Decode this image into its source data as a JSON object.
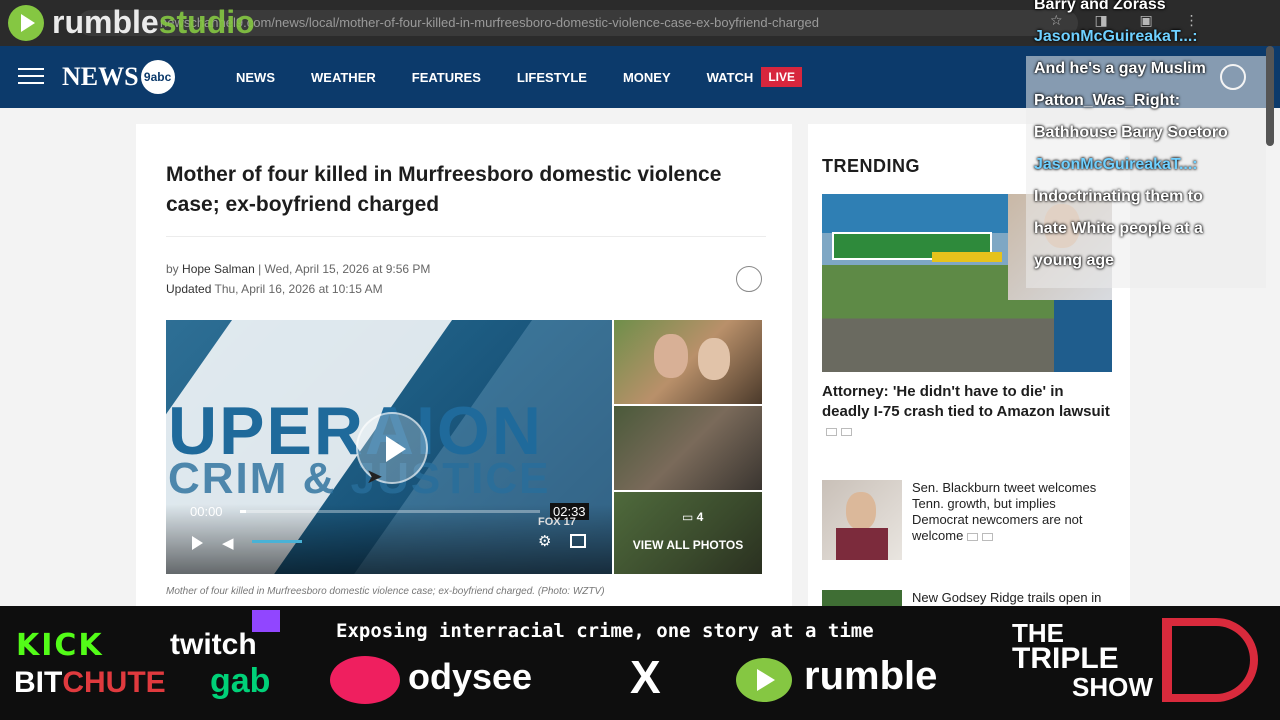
{
  "browser": {
    "url": "newschannel9.com/news/local/mother-of-four-killed-in-murfreesboro-domestic-violence-case-ex-boyfriend-charged",
    "watermark": {
      "brand": "rumble",
      "suffix": "studio"
    }
  },
  "site": {
    "logo_text": "NEWS",
    "logo_badge": "9abc",
    "nav": [
      "NEWS",
      "WEATHER",
      "FEATURES",
      "LIFESTYLE",
      "MONEY",
      "WATCH"
    ],
    "live_label": "LIVE"
  },
  "article": {
    "title": "Mother of four killed in Murfreesboro domestic violence case; ex-boyfriend charged",
    "byline_prefix": "by",
    "author": "Hope Salman",
    "published": "| Wed, April 15, 2026 at 9:56 PM",
    "updated_label": "Updated",
    "updated": "Thu, April 16, 2026 at 10:15 AM",
    "video": {
      "overlay_line1": "UPERAION",
      "overlay_line2": "CRIM & JUSTICE",
      "time_current": "00:00",
      "time_total": "02:33",
      "progress": 0.02,
      "channel_badge": "FOX 17"
    },
    "photo_count": "4",
    "view_all": "VIEW ALL PHOTOS",
    "caption": "Mother of four killed in Murfreesboro domestic violence case; ex-boyfriend charged. (Photo: WZTV)"
  },
  "trending": {
    "title": "TRENDING",
    "lead_headline": "Attorney: 'He didn't have to die' in deadly I-75 crash tied to Amazon lawsuit",
    "items": [
      {
        "headline": "Sen. Blackburn tweet welcomes Tenn. growth, but implies Democrat newcomers are not welcome"
      },
      {
        "headline": "New Godsey Ridge trails open in Red Bank"
      }
    ]
  },
  "chat": [
    {
      "text": "Barry and Zorass",
      "kind": "msg"
    },
    {
      "text": "JasonMcGuireakaT...:",
      "kind": "user"
    },
    {
      "text": "And he's a gay Muslim",
      "kind": "msg"
    },
    {
      "text": "Patton_Was_Right:",
      "kind": "msg"
    },
    {
      "text": "Bathhouse Barry Soetoro",
      "kind": "msg"
    },
    {
      "text": "JasonMcGuireakaT...:",
      "kind": "user"
    },
    {
      "text": "Indoctrinating them to",
      "kind": "msg"
    },
    {
      "text": "hate White people at a",
      "kind": "msg"
    },
    {
      "text": "young age",
      "kind": "msg"
    }
  ],
  "banner": {
    "tagline": "Exposing interracial crime, one story at a time",
    "kick": "KICK",
    "twitch": "twitch",
    "bit": "BIT",
    "chute": "CHUTE",
    "gab": "gab",
    "odysee": "odysee",
    "x": "X",
    "rumble": "rumble",
    "show_line1": "THE",
    "show_line2": "TRIPLE",
    "show_line3": "SHOW"
  },
  "colors": {
    "nav_bg": "#0c3a6b",
    "live_red": "#d7263d",
    "rumble_green": "#85c742",
    "chat_user": "#6fd0ff"
  }
}
